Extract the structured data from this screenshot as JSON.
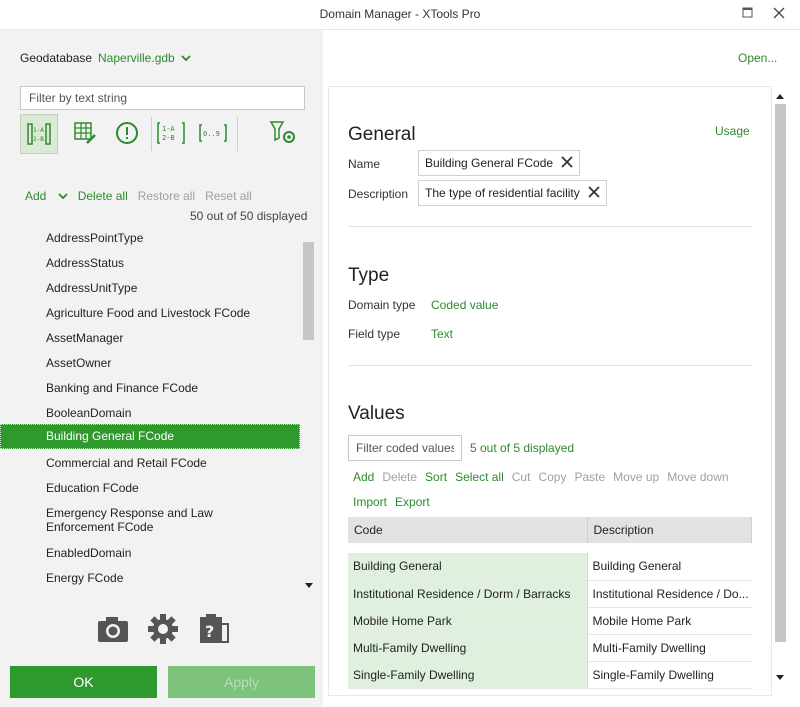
{
  "window": {
    "title": "Domain Manager  -  XTools Pro"
  },
  "geodatabase": {
    "label": "Geodatabase",
    "value": "Naperville.gdb",
    "open_label": "Open..."
  },
  "left": {
    "filter_placeholder": "Filter by text string",
    "toolbar_icons": [
      "sort-code-icon",
      "table-edit-icon",
      "warning-circle-icon",
      "sort-alpha-icon",
      "sort-numeric-icon",
      "settings-filter-icon"
    ],
    "actions": {
      "add": "Add",
      "delete_all": "Delete all",
      "restore_all": "Restore all",
      "reset_all": "Reset all"
    },
    "count_text": "50 out of 50 displayed",
    "domains": [
      "AddressPointType",
      "AddressStatus",
      "AddressUnitType",
      "Agriculture Food and Livestock FCode",
      "AssetManager",
      "AssetOwner",
      "Banking and Finance FCode",
      "BooleanDomain",
      "Building General FCode",
      "Commercial and Retail FCode",
      "Education FCode",
      "Emergency Response and Law Enforcement FCode",
      "EnabledDomain",
      "Energy FCode"
    ],
    "selected_index": 8,
    "bottom_icons": [
      "camera-icon",
      "gear-icon",
      "clipboard-icon"
    ],
    "ok_label": "OK",
    "apply_label": "Apply"
  },
  "general": {
    "heading": "General",
    "usage_label": "Usage",
    "name_label": "Name",
    "name_value": "Building General FCode",
    "description_label": "Description",
    "description_value": "The type of residential facility"
  },
  "type": {
    "heading": "Type",
    "domain_type_label": "Domain type",
    "domain_type_value": "Coded value",
    "field_type_label": "Field type",
    "field_type_value": "Text"
  },
  "values": {
    "heading": "Values",
    "filter_placeholder": "Filter coded values",
    "count_text": "5 out of 5 displayed",
    "actions_row1": [
      {
        "label": "Add",
        "enabled": true
      },
      {
        "label": "Delete",
        "enabled": false
      },
      {
        "label": "Sort",
        "enabled": true
      },
      {
        "label": "Select all",
        "enabled": true
      },
      {
        "label": "Cut",
        "enabled": false
      },
      {
        "label": "Copy",
        "enabled": false
      },
      {
        "label": "Paste",
        "enabled": false
      },
      {
        "label": "Move up",
        "enabled": false
      },
      {
        "label": "Move down",
        "enabled": false
      }
    ],
    "actions_row2": [
      {
        "label": "Import",
        "enabled": true
      },
      {
        "label": "Export",
        "enabled": true
      }
    ],
    "columns": [
      "Code",
      "Description"
    ],
    "rows": [
      {
        "code": "Building General",
        "description": "Building General"
      },
      {
        "code": "Institutional Residence / Dorm / Barracks",
        "description": "Institutional Residence / Do..."
      },
      {
        "code": "Mobile Home Park",
        "description": "Mobile Home Park"
      },
      {
        "code": "Multi-Family Dwelling",
        "description": "Multi-Family Dwelling"
      },
      {
        "code": "Single-Family Dwelling",
        "description": "Single-Family Dwelling"
      }
    ]
  },
  "colors": {
    "accent": "#2e9a2e",
    "link": "#2e8a2e",
    "selected_row": "#2e9a2e",
    "code_cell_bg": "#dff0df"
  }
}
